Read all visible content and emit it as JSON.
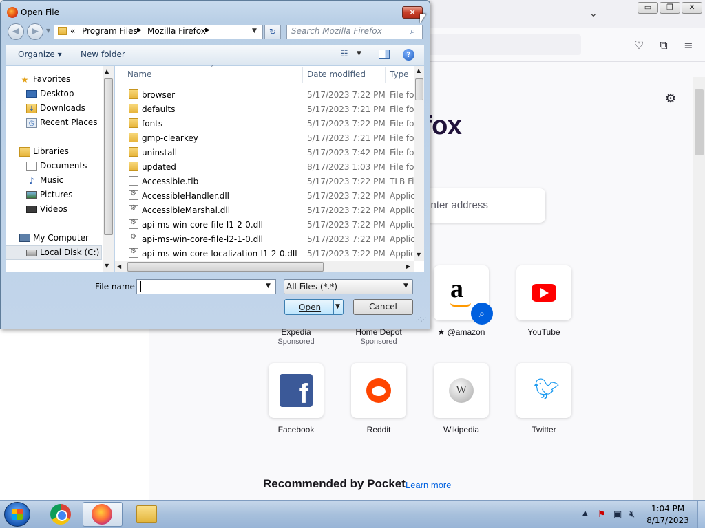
{
  "firefox": {
    "wordmark_fragment": "refox",
    "search_placeholder_fragment": "r enter address",
    "settings_icon": "gear-icon",
    "toolbar_icons": [
      "pocket-icon",
      "extensions-icon",
      "menu-icon"
    ],
    "window_controls": {
      "minimize": "▭",
      "restore": "❐",
      "close": "✕"
    },
    "shortcuts_row1": [
      {
        "label": "Expedia",
        "sub": "Sponsored"
      },
      {
        "label": "Home Depot",
        "sub": "Sponsored"
      },
      {
        "label": "@amazon",
        "sub": ""
      },
      {
        "label": "YouTube",
        "sub": ""
      }
    ],
    "shortcuts_row2": [
      {
        "label": "Facebook"
      },
      {
        "label": "Reddit"
      },
      {
        "label": "Wikipedia"
      },
      {
        "label": "Twitter"
      }
    ],
    "pocket_heading": "Recommended by Pocket",
    "pocket_link": "Learn more"
  },
  "dialog": {
    "title": "Open File",
    "close_glyph": "✕",
    "breadcrumb": [
      "«",
      "Program Files",
      "Mozilla Firefox"
    ],
    "search_placeholder": "Search Mozilla Firefox",
    "toolbar": {
      "organize": "Organize ▾",
      "new_folder": "New folder"
    },
    "nav": {
      "favorites_header": "Favorites",
      "favorites": [
        "Desktop",
        "Downloads",
        "Recent Places"
      ],
      "libraries_header": "Libraries",
      "libraries": [
        "Documents",
        "Music",
        "Pictures",
        "Videos"
      ],
      "computer_header": "My Computer",
      "computer": [
        "Local Disk (C:)"
      ]
    },
    "columns": {
      "name": "Name",
      "date": "Date modified",
      "type": "Type"
    },
    "files": [
      {
        "name": "browser",
        "date": "5/17/2023 7:22 PM",
        "type": "File fol",
        "kind": "folder"
      },
      {
        "name": "defaults",
        "date": "5/17/2023 7:21 PM",
        "type": "File fol",
        "kind": "folder"
      },
      {
        "name": "fonts",
        "date": "5/17/2023 7:22 PM",
        "type": "File fol",
        "kind": "folder"
      },
      {
        "name": "gmp-clearkey",
        "date": "5/17/2023 7:21 PM",
        "type": "File fol",
        "kind": "folder"
      },
      {
        "name": "uninstall",
        "date": "5/17/2023 7:42 PM",
        "type": "File fol",
        "kind": "folder"
      },
      {
        "name": "updated",
        "date": "8/17/2023 1:03 PM",
        "type": "File fol",
        "kind": "folder"
      },
      {
        "name": "Accessible.tlb",
        "date": "5/17/2023 7:22 PM",
        "type": "TLB Fil",
        "kind": "file"
      },
      {
        "name": "AccessibleHandler.dll",
        "date": "5/17/2023 7:22 PM",
        "type": "Applic",
        "kind": "dll"
      },
      {
        "name": "AccessibleMarshal.dll",
        "date": "5/17/2023 7:22 PM",
        "type": "Applic",
        "kind": "dll"
      },
      {
        "name": "api-ms-win-core-file-l1-2-0.dll",
        "date": "5/17/2023 7:22 PM",
        "type": "Applic",
        "kind": "dll"
      },
      {
        "name": "api-ms-win-core-file-l2-1-0.dll",
        "date": "5/17/2023 7:22 PM",
        "type": "Applic",
        "kind": "dll"
      },
      {
        "name": "api-ms-win-core-localization-l1-2-0.dll",
        "date": "5/17/2023 7:22 PM",
        "type": "Applic",
        "kind": "dll"
      }
    ],
    "filename_label": "File name:",
    "filename_value": "",
    "filter": "All Files (*.*)",
    "open_label": "Open",
    "cancel_label": "Cancel"
  },
  "taskbar": {
    "apps": [
      "chrome-icon",
      "firefox-icon",
      "explorer-icon"
    ],
    "clock_time": "1:04 PM",
    "clock_date": "8/17/2023"
  }
}
